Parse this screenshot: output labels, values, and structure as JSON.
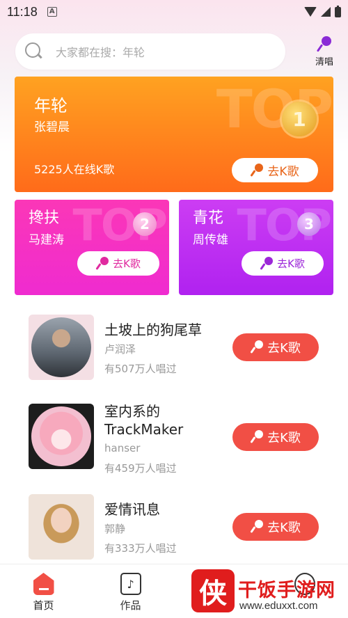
{
  "status_bar": {
    "time": "11:18",
    "notification": "A"
  },
  "search": {
    "placeholder": "大家都在搜：年轮"
  },
  "sing_button": {
    "label": "清唱"
  },
  "top_songs": [
    {
      "rank": "1",
      "title": "年轮",
      "singer": "张碧晨",
      "online": "5225人在线K歌",
      "button": "去K歌",
      "watermark": "TOP"
    },
    {
      "rank": "2",
      "title": "搀扶",
      "singer": "马建涛",
      "button": "去K歌",
      "watermark": "TOP"
    },
    {
      "rank": "3",
      "title": "青花",
      "singer": "周传雄",
      "button": "去K歌",
      "watermark": "TOP"
    }
  ],
  "song_list": [
    {
      "title": "土坡上的狗尾草",
      "artist": "卢润泽",
      "plays": "有507万人唱过",
      "button": "去K歌"
    },
    {
      "title": "室内系的TrackMaker",
      "artist": "hanser",
      "plays": "有459万人唱过",
      "button": "去K歌"
    },
    {
      "title": "爱情讯息",
      "artist": "郭静",
      "plays": "有333万人唱过",
      "button": "去K歌"
    }
  ],
  "bottom_nav": [
    {
      "label": "首页",
      "icon": "home-icon",
      "active": true
    },
    {
      "label": "作品",
      "icon": "works-icon",
      "active": false
    },
    {
      "label": "",
      "icon": "square-icon",
      "active": false
    },
    {
      "label": "",
      "icon": "mine-icon",
      "active": false
    }
  ],
  "watermark": {
    "logo_char": "侠",
    "name": "干饭手游网",
    "url": "www.eduxxt.com"
  },
  "colors": {
    "accent_red": "#f14f45",
    "top1_orange": "#ff8a1f",
    "top2_pink": "#f531c4",
    "top3_purple": "#bb2cf1"
  }
}
